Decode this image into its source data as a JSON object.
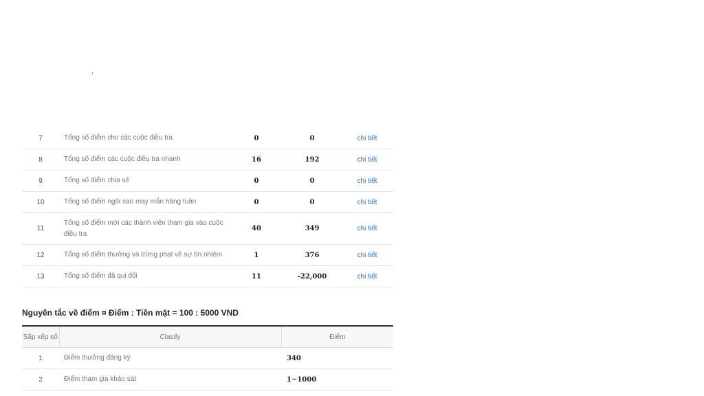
{
  "dot": ".",
  "points_table": {
    "rows": [
      {
        "no": "7",
        "desc": "Tổng số điểm cho các cuộc điều tra",
        "v1": "0",
        "v2": "0",
        "link": "chi tiết"
      },
      {
        "no": "8",
        "desc": "Tổng số điểm các cuộc điều tra nhanh",
        "v1": "16",
        "v2": "192",
        "link": "chi tiết"
      },
      {
        "no": "9",
        "desc": "Tổng số điểm chia sẻ",
        "v1": "0",
        "v2": "0",
        "link": "chi tiết"
      },
      {
        "no": "10",
        "desc": "Tổng số điểm ngôi sao may mắn hàng tuần",
        "v1": "0",
        "v2": "0",
        "link": "chi tiết"
      },
      {
        "no": "11",
        "desc": "Tổng số điểm mời các thành viên tham gia vào cuộc điều tra",
        "v1": "40",
        "v2": "349",
        "link": "chi tiết"
      },
      {
        "no": "12",
        "desc": "Tổng số điểm thưởng và trừng phạt về sự tín nhiệm",
        "v1": "1",
        "v2": "376",
        "link": "chi tiết"
      },
      {
        "no": "13",
        "desc": "Tổng số điểm đã qui đổi",
        "v1": "11",
        "v2": "-22,000",
        "link": "chi tiết"
      }
    ]
  },
  "rules": {
    "title": "Nguyên tắc về điểm ¤ Điểm : Tiền mặt = 100 : 5000 VND",
    "headers": {
      "no": "Sắp xếp số",
      "classify": "Clasify",
      "points": "Điểm"
    },
    "rows": [
      {
        "no": "1",
        "classify": "Điểm thưởng đăng ký",
        "points": "340"
      },
      {
        "no": "2",
        "classify": "Điểm tham gia khảo sát",
        "points": "1~1000"
      }
    ]
  }
}
